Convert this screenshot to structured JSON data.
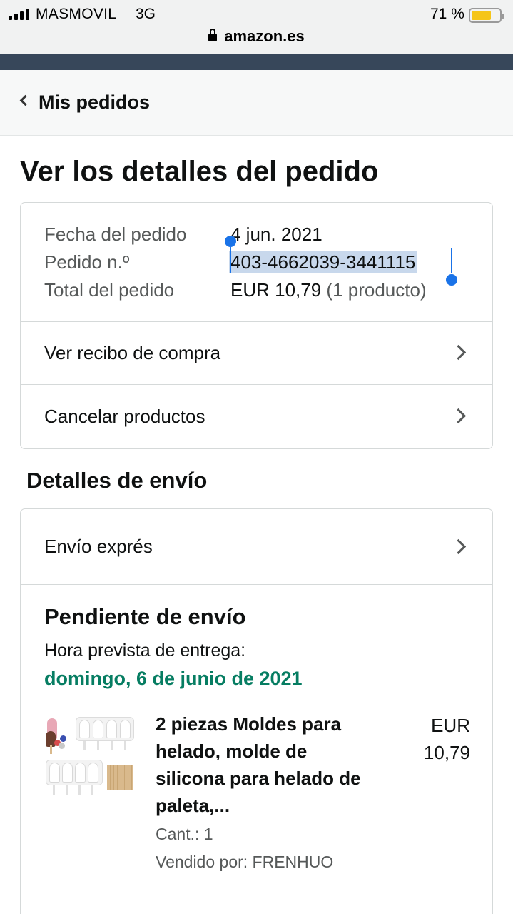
{
  "status_bar": {
    "carrier": "MASMOVIL",
    "network": "3G",
    "battery_percent": "71 %",
    "battery_level": 0.71,
    "url": "amazon.es",
    "icons": [
      "signal-icon",
      "lock-icon",
      "battery-icon"
    ]
  },
  "nav": {
    "back_label": "Mis pedidos"
  },
  "page": {
    "title": "Ver los detalles del pedido"
  },
  "order_summary": {
    "date_label": "Fecha del pedido",
    "date_value": "4 jun. 2021",
    "number_label": "Pedido n.º",
    "number_value": "403-4662039-3441115",
    "total_label": "Total del pedido",
    "total_value": "EUR 10,79",
    "total_items": "(1 producto)"
  },
  "actions": [
    {
      "label": "Ver recibo de compra"
    },
    {
      "label": "Cancelar productos"
    }
  ],
  "shipping": {
    "section_title": "Detalles de envío",
    "method": "Envío exprés",
    "status": "Pendiente de envío",
    "eta_label": "Hora prevista de entrega:",
    "eta_date": "domingo, 6 de junio de 2021",
    "eta_color": "#067d62"
  },
  "product": {
    "title": "2 piezas Moldes para helado, molde de silicona para helado de paleta,...",
    "price": "EUR 10,79",
    "quantity": "Cant.: 1",
    "seller": "Vendido por: FRENHUO",
    "image": "ice-pop-molds-image"
  },
  "colors": {
    "header_band": "#37475a",
    "selection": "#1a73e8",
    "selection_bg": "#c8d8ec",
    "battery": "#f5c518"
  }
}
